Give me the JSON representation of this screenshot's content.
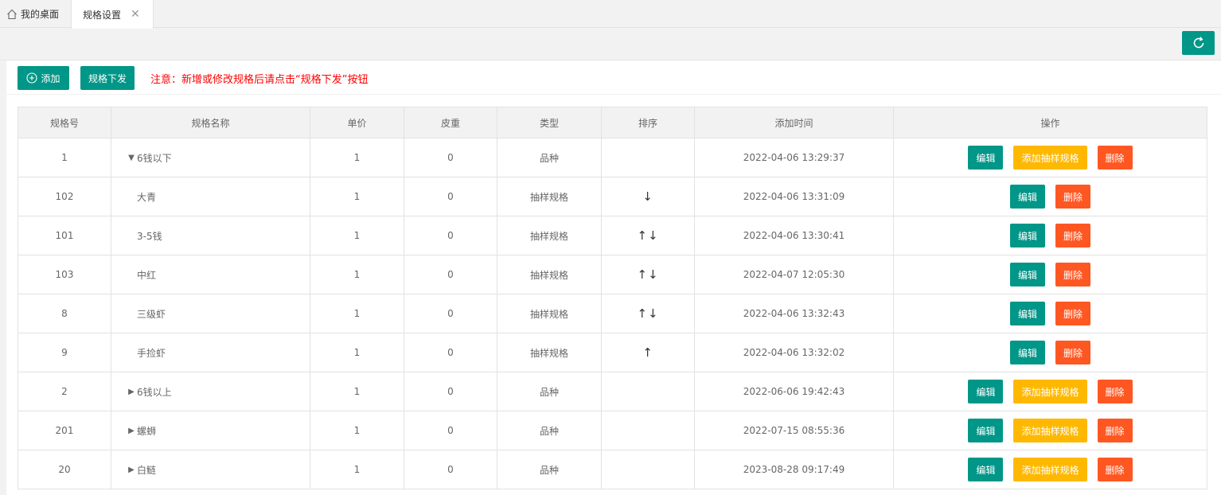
{
  "tabs": {
    "home_label": "我的桌面",
    "active_label": "规格设置",
    "close_glyph": "✕"
  },
  "toolbar": {
    "add_label": "添加",
    "issue_label": "规格下发",
    "notice": "注意：新增或修改规格后请点击“规格下发”按钮"
  },
  "table": {
    "headers": [
      "规格号",
      "规格名称",
      "单价",
      "皮重",
      "类型",
      "排序",
      "添加时间",
      "操作"
    ],
    "edit_label": "编辑",
    "add_sample_label": "添加抽样规格",
    "delete_label": "删除",
    "rows": [
      {
        "id": "1",
        "name": "6钱以下",
        "price": "1",
        "tare": "0",
        "type": "品种",
        "sort": "",
        "time": "2022-04-06 13:29:37",
        "level": "parent",
        "expanded": true
      },
      {
        "id": "102",
        "name": "大青",
        "price": "1",
        "tare": "0",
        "type": "抽样规格",
        "sort": "↓",
        "time": "2022-04-06 13:31:09",
        "level": "child"
      },
      {
        "id": "101",
        "name": "3-5钱",
        "price": "1",
        "tare": "0",
        "type": "抽样规格",
        "sort": "↑↓",
        "time": "2022-04-06 13:30:41",
        "level": "child"
      },
      {
        "id": "103",
        "name": "中红",
        "price": "1",
        "tare": "0",
        "type": "抽样规格",
        "sort": "↑↓",
        "time": "2022-04-07 12:05:30",
        "level": "child"
      },
      {
        "id": "8",
        "name": "三级虾",
        "price": "1",
        "tare": "0",
        "type": "抽样规格",
        "sort": "↑↓",
        "time": "2022-04-06 13:32:43",
        "level": "child"
      },
      {
        "id": "9",
        "name": "手捡虾",
        "price": "1",
        "tare": "0",
        "type": "抽样规格",
        "sort": "↑",
        "time": "2022-04-06 13:32:02",
        "level": "child"
      },
      {
        "id": "2",
        "name": "6钱以上",
        "price": "1",
        "tare": "0",
        "type": "品种",
        "sort": "",
        "time": "2022-06-06 19:42:43",
        "level": "parent",
        "expanded": false
      },
      {
        "id": "201",
        "name": "螺蛳",
        "price": "1",
        "tare": "0",
        "type": "品种",
        "sort": "",
        "time": "2022-07-15 08:55:36",
        "level": "parent",
        "expanded": false
      },
      {
        "id": "20",
        "name": "白鲢",
        "price": "1",
        "tare": "0",
        "type": "品种",
        "sort": "",
        "time": "2023-08-28 09:17:49",
        "level": "parent",
        "expanded": false
      }
    ]
  }
}
